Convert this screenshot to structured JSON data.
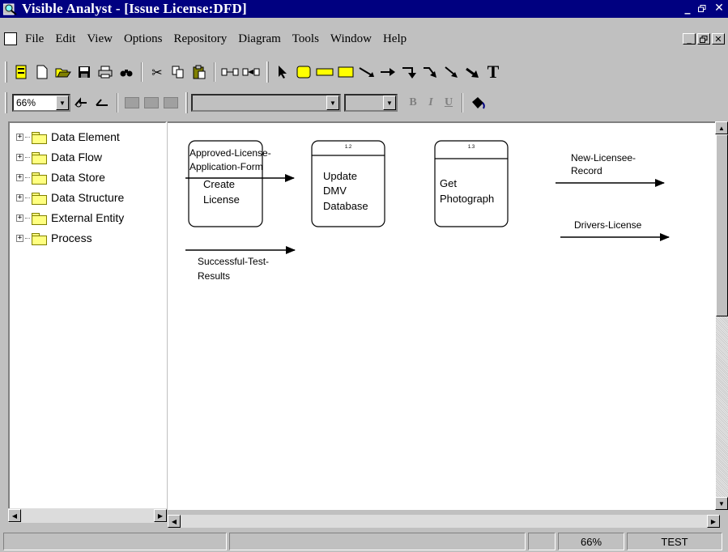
{
  "window": {
    "title": "Visible Analyst - [Issue License:DFD]",
    "minimize": "_",
    "maximize": "▫",
    "close": "✕"
  },
  "menu": {
    "items": [
      {
        "label": "File"
      },
      {
        "label": "Edit"
      },
      {
        "label": "View"
      },
      {
        "label": "Options"
      },
      {
        "label": "Repository"
      },
      {
        "label": "Diagram"
      },
      {
        "label": "Tools"
      },
      {
        "label": "Window"
      },
      {
        "label": "Help"
      }
    ]
  },
  "toolbar2": {
    "zoom_value": "66%",
    "bold": "B",
    "italic": "I",
    "underline": "U"
  },
  "tree": {
    "items": [
      {
        "label": "Data Element"
      },
      {
        "label": "Data Flow"
      },
      {
        "label": "Data Store"
      },
      {
        "label": "Data Structure"
      },
      {
        "label": "External Entity"
      },
      {
        "label": "Process"
      }
    ]
  },
  "diagram": {
    "processes": [
      {
        "id": "",
        "lines": [
          "Create",
          "License"
        ]
      },
      {
        "id": "1.2",
        "lines": [
          "Update",
          "DMV",
          "Database"
        ]
      },
      {
        "id": "1.3",
        "lines": [
          "Get",
          "Photograph"
        ]
      }
    ],
    "flows": [
      {
        "lines": [
          "Approved-License-",
          "Application-Form"
        ]
      },
      {
        "lines": [
          "Successful-Test-",
          "Results"
        ]
      },
      {
        "lines": [
          "New-Licensee-",
          "Record"
        ]
      },
      {
        "lines": [
          "Drivers-License"
        ]
      }
    ]
  },
  "status": {
    "zoom": "66%",
    "mode": "TEST"
  },
  "colors": {
    "title_bg": "#000080",
    "chrome": "#c0c0c0",
    "folder": "#ffff80"
  }
}
